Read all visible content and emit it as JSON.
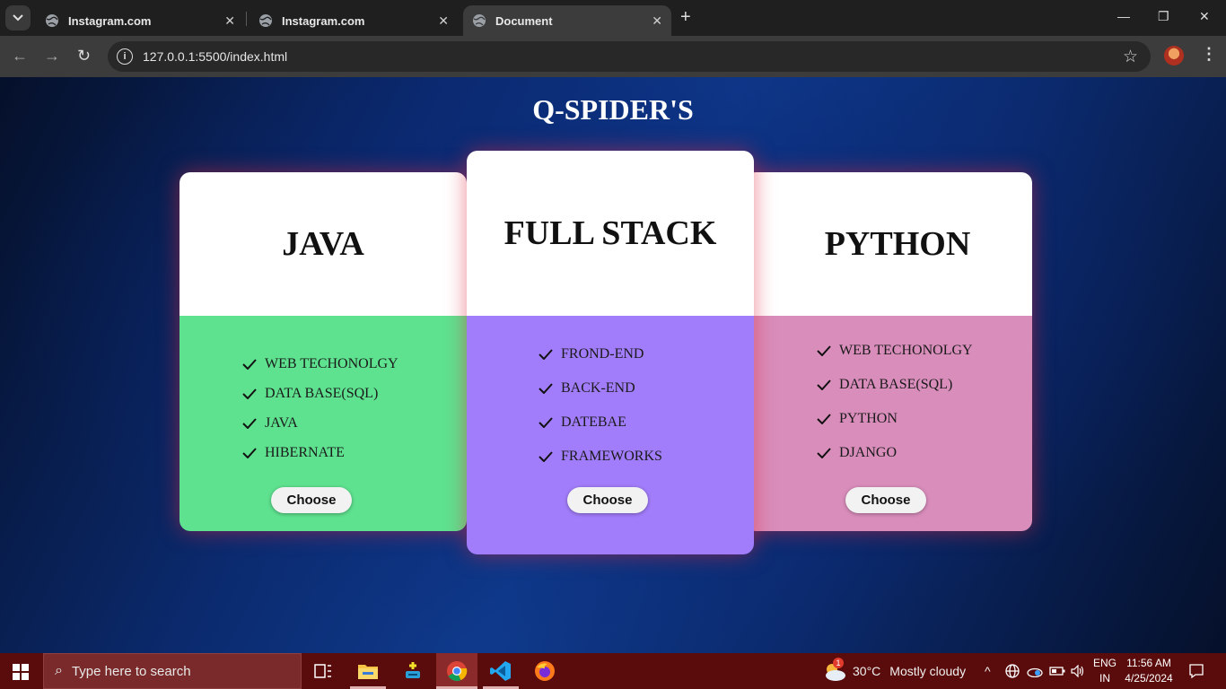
{
  "browser": {
    "tabs": [
      {
        "title": "Instagram.com",
        "active": false
      },
      {
        "title": "Instagram.com",
        "active": false
      },
      {
        "title": "Document",
        "active": true
      }
    ],
    "url": "127.0.0.1:5500/index.html"
  },
  "page": {
    "title": "Q-SPIDER'S",
    "cards": [
      {
        "name": "JAVA",
        "color": "#5ee28f",
        "features": [
          "WEB TECHONOLGY",
          "DATA BASE(SQL)",
          "JAVA",
          "HIBERNATE"
        ],
        "button": "Choose"
      },
      {
        "name": "FULL STACK",
        "color": "#a27dfb",
        "features": [
          "FROND-END",
          "BACK-END",
          "DATEBAE",
          "FRAMEWORKS"
        ],
        "button": "Choose"
      },
      {
        "name": "PYTHON",
        "color": "#d98dbb",
        "features": [
          "WEB TECHONOLGY",
          "DATA BASE(SQL)",
          "PYTHON",
          "DJANGO"
        ],
        "button": "Choose"
      }
    ]
  },
  "taskbar": {
    "search_placeholder": "Type here to search",
    "weather_temp": "30°C",
    "weather_text": "Mostly cloudy",
    "weather_badge": "1",
    "lang_top": "ENG",
    "lang_bottom": "IN",
    "time": "11:56 AM",
    "date": "4/25/2024",
    "apps": [
      "task-view",
      "file-explorer",
      "app-installer",
      "chrome",
      "vscode",
      "firefox"
    ]
  }
}
